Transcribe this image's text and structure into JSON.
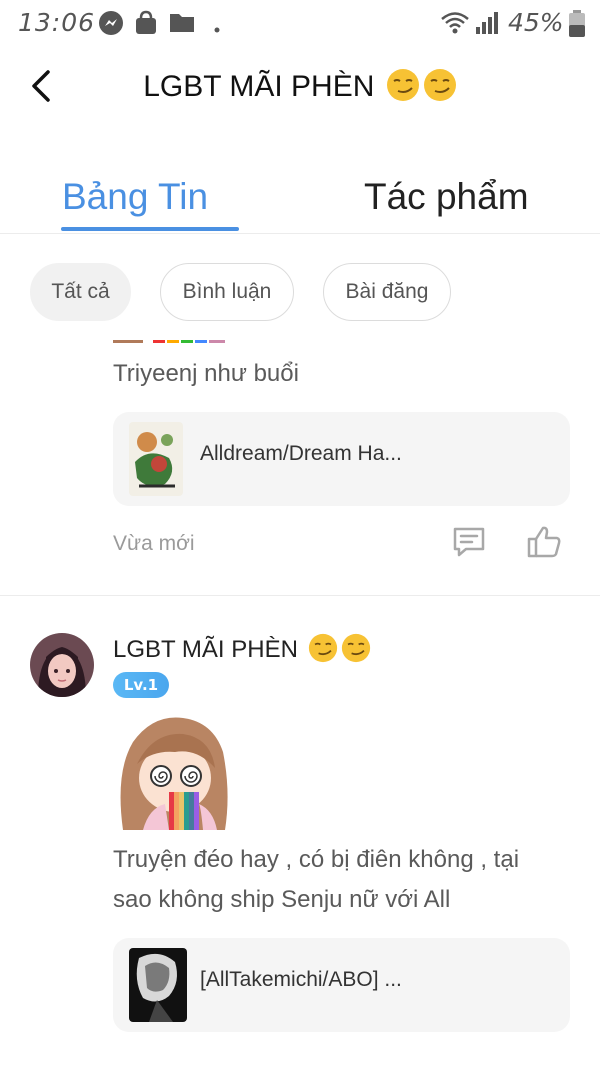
{
  "status_bar": {
    "time": "13:06",
    "battery_percent": "45%",
    "icons": [
      "messenger-icon",
      "shopping-bag-icon",
      "folder-icon",
      "dot-icon",
      "wifi-icon",
      "signal-icon",
      "battery-icon"
    ]
  },
  "header": {
    "title": "LGBT MÃI PHÈN",
    "title_emoji": "smirk-face-emoji"
  },
  "tabs": [
    {
      "label": "Bảng Tin",
      "active": true
    },
    {
      "label": "Tác phẩm",
      "active": false
    }
  ],
  "filters": [
    {
      "label": "Tất cả",
      "active": true
    },
    {
      "label": "Bình luận",
      "active": false
    },
    {
      "label": "Bài đăng",
      "active": false
    }
  ],
  "posts": [
    {
      "text": "Triyeenj như buổi",
      "work_title": "Alldream/Dream Ha...",
      "time": "Vừa mới",
      "actions": [
        "comment-icon",
        "like-icon"
      ]
    },
    {
      "author": "LGBT MÃI PHÈN",
      "level": "Lv.1",
      "text_line1": "Truyện đéo hay , có bị điên không , tại",
      "text_line2": "sao không ship Senju nữ với All",
      "work_title": "[AllTakemichi/ABO] ..."
    }
  ],
  "colors": {
    "accent": "#4a90e2",
    "chip_active_bg": "#f1f1f1",
    "card_bg": "#f5f5f5",
    "muted_text": "#9a9a9a",
    "level_badge": "#4aa6ee"
  }
}
